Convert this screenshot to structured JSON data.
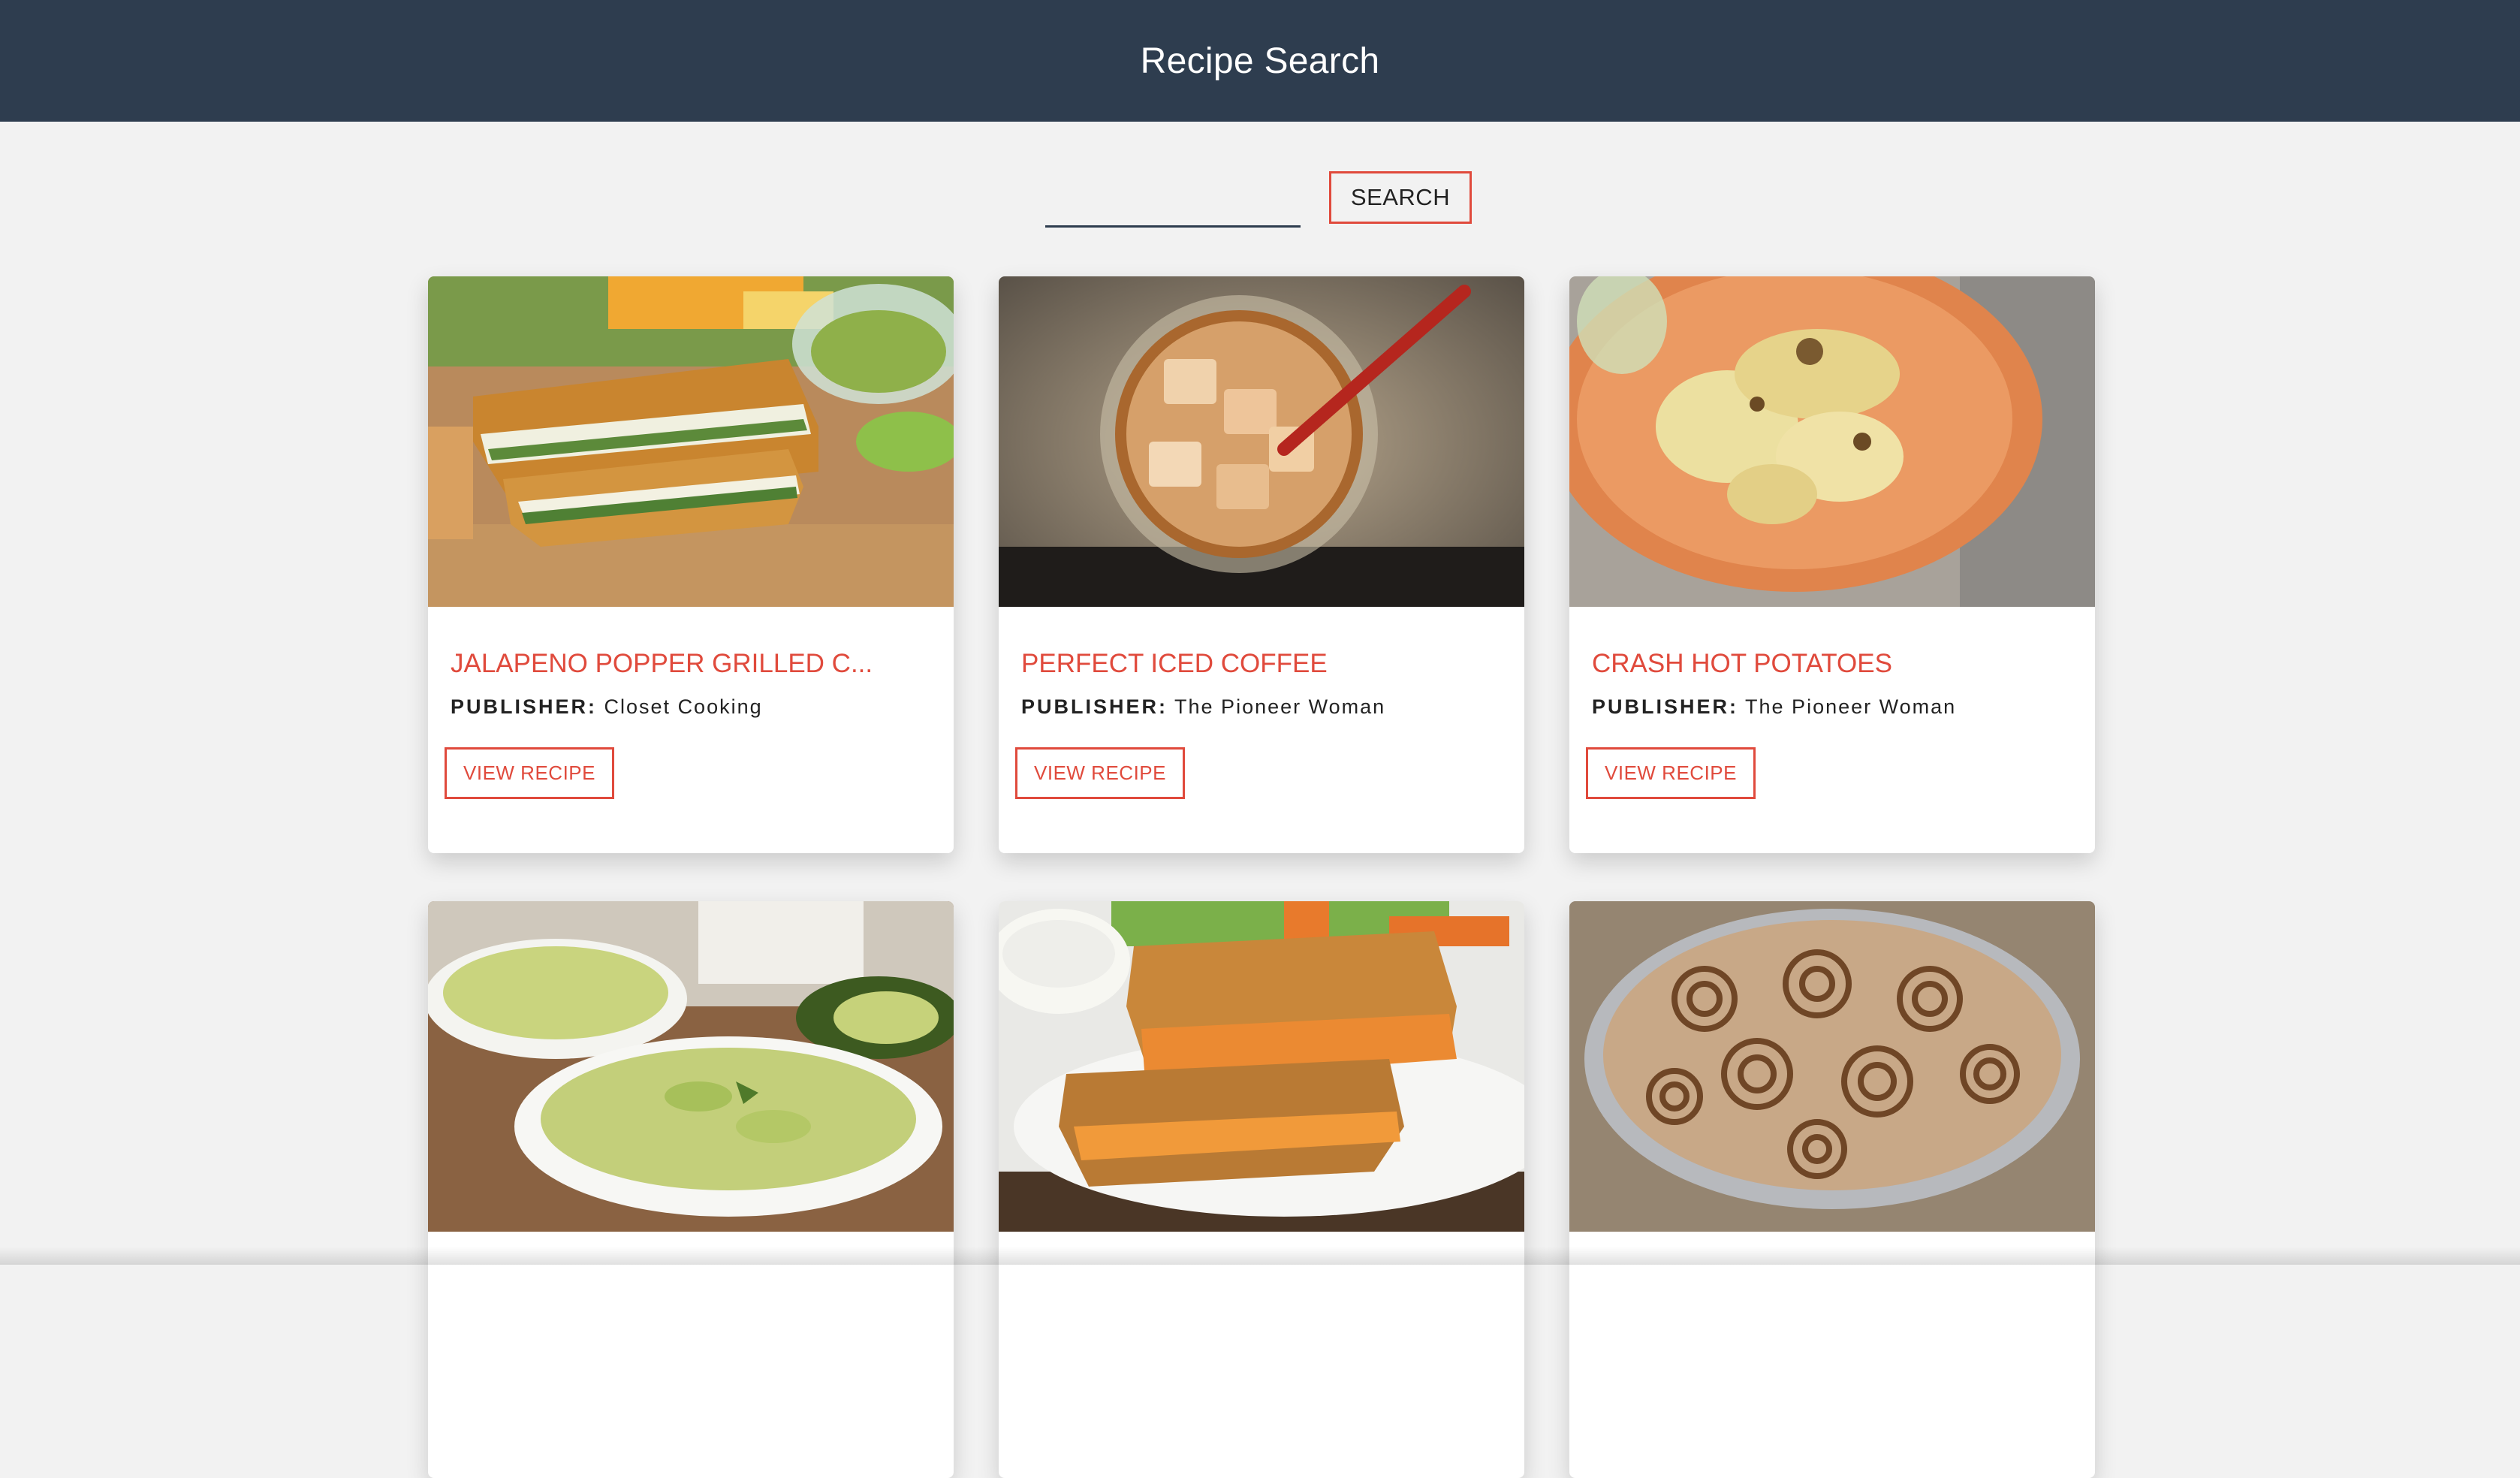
{
  "header": {
    "title": "Recipe Search"
  },
  "search": {
    "placeholder": "",
    "value": "",
    "button_label": "SEARCH"
  },
  "recipes": [
    {
      "title": "JALAPENO POPPER GRILLED C...",
      "publisher_label": "PUBLISHER:",
      "publisher": "Closet Cooking",
      "button_label": "VIEW RECIPE"
    },
    {
      "title": "PERFECT ICED COFFEE",
      "publisher_label": "PUBLISHER:",
      "publisher": "The Pioneer Woman",
      "button_label": "VIEW RECIPE"
    },
    {
      "title": "CRASH HOT POTATOES",
      "publisher_label": "PUBLISHER:",
      "publisher": "The Pioneer Woman",
      "button_label": "VIEW RECIPE"
    },
    {
      "title": "",
      "publisher_label": "",
      "publisher": "",
      "button_label": ""
    },
    {
      "title": "",
      "publisher_label": "",
      "publisher": "",
      "button_label": ""
    },
    {
      "title": "",
      "publisher_label": "",
      "publisher": "",
      "button_label": ""
    }
  ],
  "colors": {
    "header_bg": "#2e3d4f",
    "accent": "#e04a3c",
    "page_bg": "#f2f2f2"
  }
}
